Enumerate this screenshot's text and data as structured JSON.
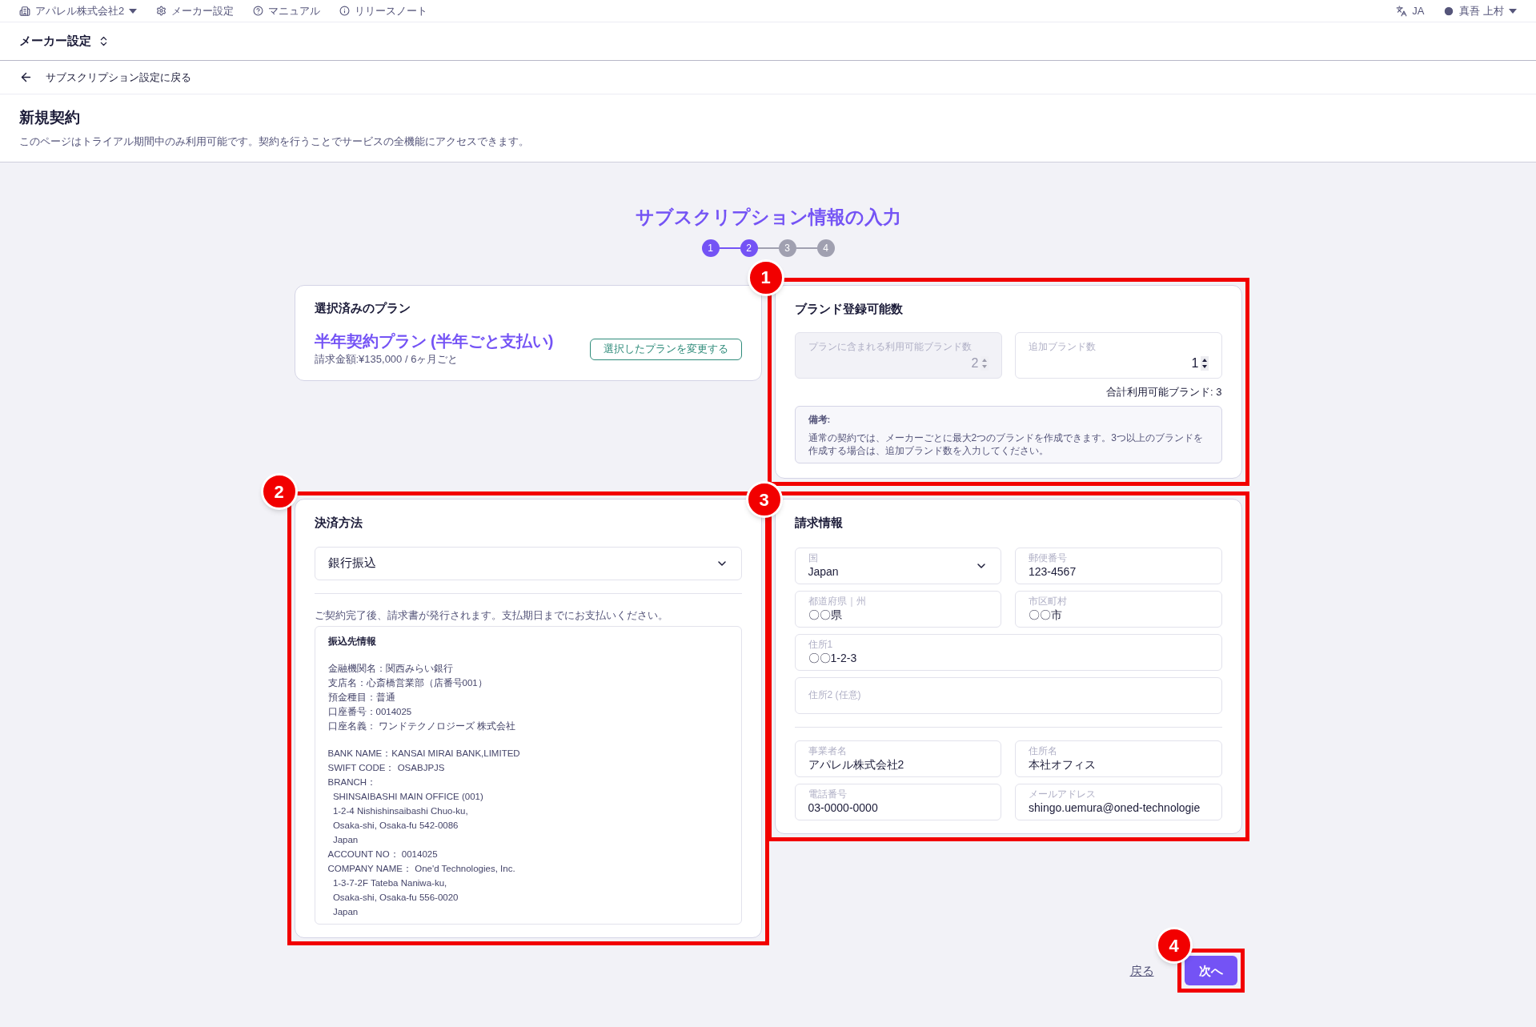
{
  "top_bar": {
    "company": "アパレル株式会社2",
    "links": [
      {
        "kind": "gear",
        "label": "メーカー設定"
      },
      {
        "kind": "help",
        "label": "マニュアル"
      },
      {
        "kind": "info",
        "label": "リリースノート"
      }
    ],
    "language": "JA",
    "user": "真吾 上村"
  },
  "header": {
    "title": "メーカー設定"
  },
  "back_link": "サブスクリプション設定に戻る",
  "page": {
    "title": "新規契約",
    "description": "このページはトライアル期間中のみ利用可能です。契約を行うことでサービスの全機能にアクセスできます。"
  },
  "wizard": {
    "title": "サブスクリプション情報の入力",
    "steps": [
      {
        "label": "1",
        "selected": true
      },
      {
        "label": "2",
        "selected": true
      },
      {
        "label": "3",
        "selected": false
      },
      {
        "label": "4",
        "selected": false
      }
    ]
  },
  "plan": {
    "heading": "選択済みのプラン",
    "name": "半年契約プラン (半年ごと支払い)",
    "price": "請求金額:¥135,000 / 6ヶ月ごと",
    "change_button": "選択したプランを変更する"
  },
  "brands": {
    "heading": "ブランド登録可能数",
    "fields": [
      {
        "label": "プランに含まれる利用可能ブランド数",
        "value": "2",
        "disabled": true
      },
      {
        "label": "追加ブランド数",
        "value": "1",
        "disabled": false
      }
    ],
    "total": "合計利用可能ブランド: 3",
    "note_title": "備考:",
    "note": "通常の契約では、メーカーごとに最大2つのブランドを作成できます。3つ以上のブランドを作成する場合は、追加ブランド数を入力してください。"
  },
  "payment": {
    "heading": "決済方法",
    "method": "銀行振込",
    "message": "ご契約完了後、請求書が発行されます。支払期日までにお支払いください。",
    "bank_info": {
      "title": "振込先情報",
      "sections": [
        [
          "金融機関名：関西みらい銀行",
          "支店名：心斎橋営業部（店番号001）",
          "預金種目：普通",
          "口座番号：0014025",
          "口座名義： ワンドテクノロジーズ 株式会社"
        ],
        [
          "BANK NAME：KANSAI MIRAI BANK,LIMITED",
          "SWIFT CODE： OSABJPJS",
          "BRANCH：",
          "  SHINSAIBASHI MAIN OFFICE (001)",
          "  1-2-4 Nishishinsaibashi Chuo-ku,",
          "  Osaka-shi, Osaka-fu 542-0086",
          "  Japan",
          "ACCOUNT NO： 0014025",
          "COMPANY NAME： One'd Technologies, Inc.",
          "  1-3-7-2F Tateba Naniwa-ku,",
          "  Osaka-shi, Osaka-fu 556-0020",
          "  Japan"
        ]
      ]
    }
  },
  "billing": {
    "heading": "請求情報",
    "address_fields": [
      {
        "kind": "select",
        "label": "国",
        "value": "Japan",
        "span": false
      },
      {
        "kind": "text",
        "label": "郵便番号",
        "value": "123-4567",
        "span": false
      },
      {
        "kind": "text",
        "label": "都道府県｜州",
        "value": "〇〇県",
        "span": false
      },
      {
        "kind": "text",
        "label": "市区町村",
        "value": "〇〇市",
        "span": false
      },
      {
        "kind": "text",
        "label": "住所1",
        "value": "〇〇1-2-3",
        "span": true
      },
      {
        "kind": "text",
        "label": "住所2 (任意)",
        "span": true
      }
    ],
    "contact_fields": [
      {
        "label": "事業者名",
        "value": "アパレル株式会社2",
        "span": false
      },
      {
        "label": "住所名",
        "value": "本社オフィス",
        "span": false
      },
      {
        "label": "電話番号",
        "value": "03-0000-0000",
        "span": false
      },
      {
        "label": "メールアドレス",
        "value": "shingo.uemura@oned-technologie",
        "span": false
      }
    ]
  },
  "actions": {
    "back": "戻る",
    "next": "次へ"
  },
  "annotations": [
    "1",
    "2",
    "3",
    "4"
  ]
}
